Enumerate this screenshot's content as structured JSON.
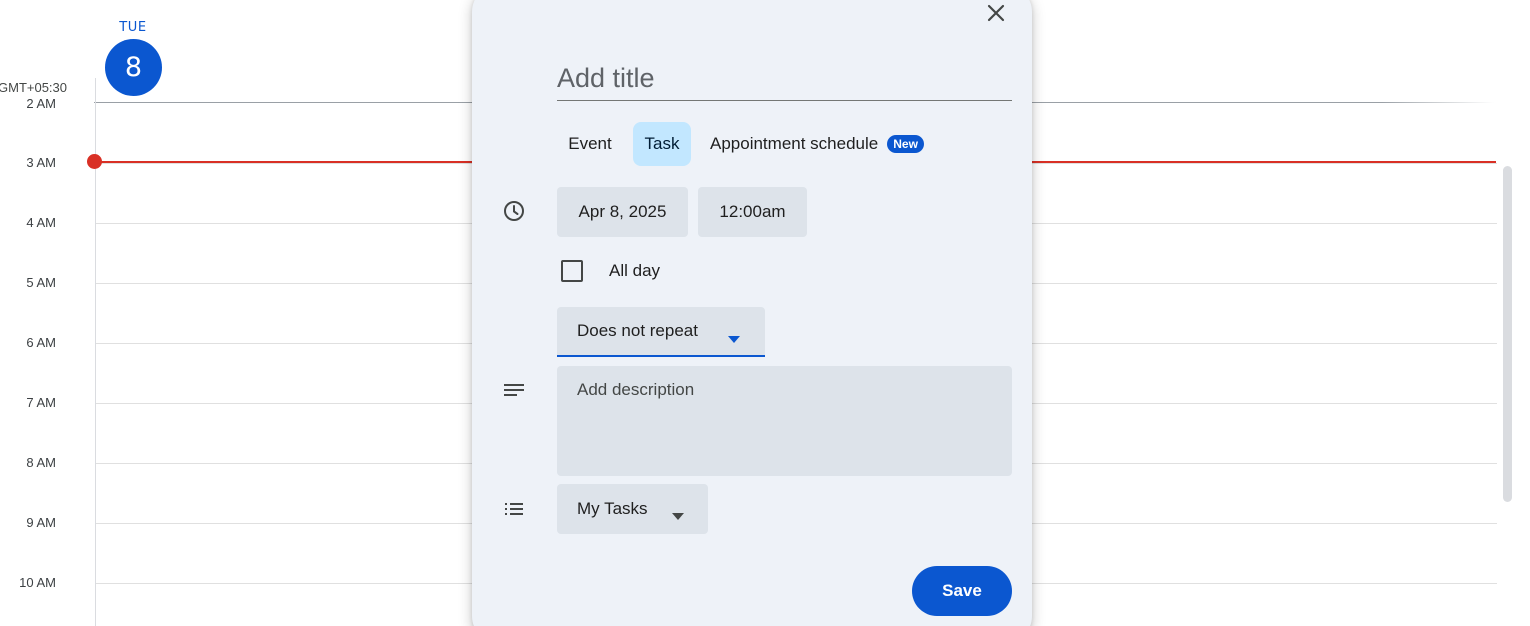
{
  "calendar": {
    "day_label": "TUE",
    "day_number": "8",
    "timezone": "GMT+05:30",
    "hours": [
      "2 AM",
      "3 AM",
      "4 AM",
      "5 AM",
      "6 AM",
      "7 AM",
      "8 AM",
      "9 AM",
      "10 AM"
    ],
    "current_time_color": "#d93025",
    "accent_color": "#0b57d0"
  },
  "dialog": {
    "close_icon": "close-icon",
    "title_placeholder": "Add title",
    "tabs": {
      "event": "Event",
      "task": "Task",
      "appointment": "Appointment schedule",
      "new_badge": "New",
      "selected": "Task"
    },
    "date": "Apr 8, 2025",
    "time": "12:00am",
    "all_day_label": "All day",
    "all_day_checked": false,
    "repeat": "Does not repeat",
    "description_placeholder": "Add description",
    "task_list": "My Tasks",
    "save_label": "Save",
    "icons": {
      "time": "clock-icon",
      "description": "notes-icon",
      "list": "list-icon"
    }
  }
}
